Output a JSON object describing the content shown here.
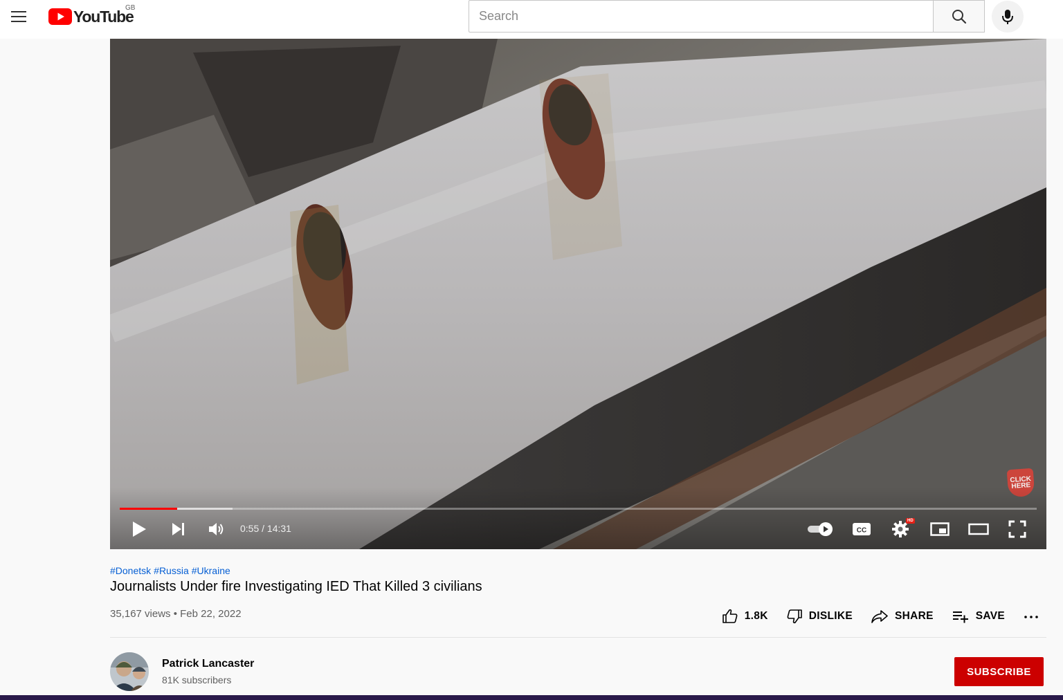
{
  "header": {
    "logo_text": "YouTube",
    "country_code": "GB",
    "search_placeholder": "Search"
  },
  "player": {
    "current_time": "0:55",
    "duration": "14:31",
    "time_display": "0:55 / 14:31",
    "played_fraction": 0.063,
    "buffered_fraction": 0.123,
    "overlay_badge_lines": [
      "CLICK",
      "HERE"
    ],
    "hd_badge": "HD",
    "cc_label": "CC"
  },
  "video": {
    "hashtags": [
      "#Donetsk",
      "#Russia",
      "#Ukraine"
    ],
    "title": "Journalists Under fire Investigating IED That Killed 3 civilians",
    "meta": "35,167 views • Feb 22, 2022",
    "likes": "1.8K",
    "dislike_label": "DISLIKE",
    "share_label": "SHARE",
    "save_label": "SAVE"
  },
  "channel": {
    "name": "Patrick Lancaster",
    "subscribers": "81K subscribers",
    "subscribe_label": "SUBSCRIBE"
  },
  "colors": {
    "brand_red": "#ff0000",
    "subscribe_red": "#cc0000",
    "link_blue": "#065fd4"
  }
}
